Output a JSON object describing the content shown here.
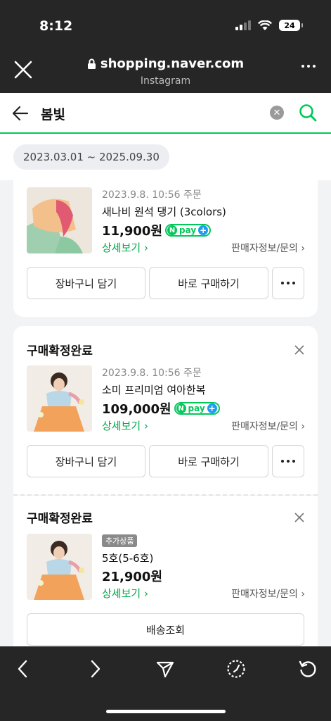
{
  "status_bar": {
    "time": "8:12",
    "battery": "24"
  },
  "browser": {
    "url": "shopping.naver.com",
    "subtitle": "Instagram"
  },
  "search": {
    "query": "봄빛",
    "clear_glyph": "✕"
  },
  "filter": {
    "date_range": "2023.03.01 ~ 2025.09.30"
  },
  "npay": {
    "n": "N",
    "pay": "pay",
    "plus": "+"
  },
  "orders": [
    {
      "order_date": "2023.9.8. 10:56 주문",
      "product_name": "새나비 원석 댕기 (3colors)",
      "price": "11,900원",
      "detail_link": "상세보기 ›",
      "seller_link": "판매자정보/문의 ›",
      "cart_button": "장바구니 담기",
      "buy_button": "바로 구매하기"
    },
    {
      "status": "구매확정완료",
      "order_date": "2023.9.8. 10:56 주문",
      "product_name": "소미 프리미엄 여아한복",
      "price": "109,000원",
      "detail_link": "상세보기 ›",
      "seller_link": "판매자정보/문의 ›",
      "cart_button": "장바구니 담기",
      "buy_button": "바로 구매하기"
    },
    {
      "status": "구매확정완료",
      "badge": "추가상품",
      "product_name": "5호(5-6호)",
      "price": "21,900원",
      "detail_link": "상세보기 ›",
      "seller_link": "판매자정보/문의 ›",
      "shipping_button": "배송조회"
    }
  ],
  "colors": {
    "naver_green": "#03c75a",
    "link_green": "#03a94e",
    "dark_bar": "#262626"
  },
  "icons": [
    "close-icon",
    "lock-icon",
    "more-icon",
    "back-arrow-icon",
    "clear-icon",
    "search-icon",
    "x-icon",
    "nav-back-icon",
    "nav-forward-icon",
    "share-icon",
    "compass-icon",
    "reload-icon"
  ]
}
